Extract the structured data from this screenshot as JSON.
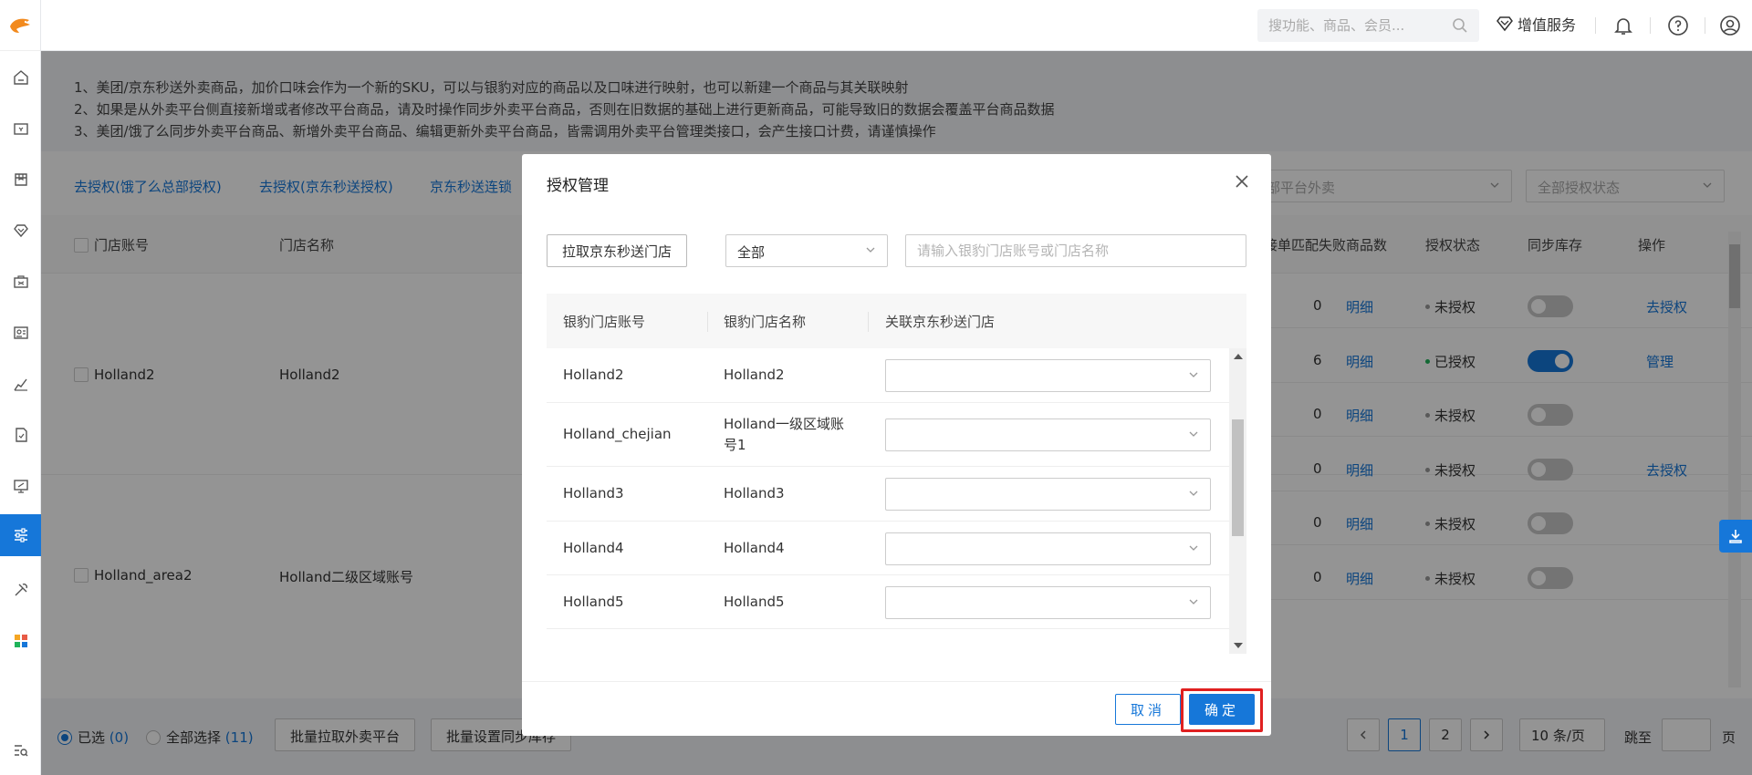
{
  "header": {
    "search_placeholder": "搜功能、商品、会员...",
    "vip_label": "增值服务"
  },
  "notice": {
    "lines": [
      "1、美团/京东秒送外卖商品，加价口味会作为一个新的SKU，可以与银豹对应的商品以及口味进行映射，也可以新建一个商品与其关联映射",
      "2、如果是从外卖平台侧直接新增或者修改平台商品，请及时操作同步外卖平台商品，否则在旧数据的基础上进行更新商品，可能导致旧的数据会覆盖平台商品数据",
      "3、美团/饿了么同步外卖平台商品、新增外卖平台商品、编辑更新外卖平台商品，皆需调用外卖平台管理类接口，会产生接口计费，请谨慎操作"
    ]
  },
  "toolbar": {
    "link1": "去授权(饿了么总部授权)",
    "link2": "去授权(京东秒送授权)",
    "link3": "京东秒送连锁",
    "platform_select": "部平台外卖",
    "auth_select": "全部授权状态"
  },
  "table": {
    "headers": {
      "account": "门店账号",
      "name": "门店名称",
      "fail_count": "接单匹配失败商品数",
      "auth_status": "授权状态",
      "sync_stock": "同步库存",
      "action": "操作"
    },
    "groups": [
      {
        "account": "Holland2",
        "name": "Holland2"
      },
      {
        "account": "Holland_area2",
        "name": "Holland二级区域账号"
      }
    ],
    "rows": [
      {
        "num": "0",
        "detail": "明细",
        "status": "未授权",
        "authorized": false,
        "action": "去授权"
      },
      {
        "num": "6",
        "detail": "明细",
        "status": "已授权",
        "authorized": true,
        "action": "管理"
      },
      {
        "num": "0",
        "detail": "明细",
        "status": "未授权",
        "authorized": false,
        "action": ""
      },
      {
        "num": "0",
        "detail": "明细",
        "status": "未授权",
        "authorized": false,
        "action": "去授权"
      },
      {
        "num": "0",
        "detail": "明细",
        "status": "未授权",
        "authorized": false,
        "action": ""
      },
      {
        "num": "0",
        "detail": "明细",
        "status": "未授权",
        "authorized": false,
        "action": ""
      }
    ]
  },
  "footer": {
    "selected_label": "已选",
    "selected_count": "(0)",
    "select_all_label": "全部选择",
    "select_all_count": "(11)",
    "batch_pull": "批量拉取外卖平台",
    "batch_sync": "批量设置同步库存",
    "page1": "1",
    "page2": "2",
    "page_size": "10 条/页",
    "jump_label": "跳至",
    "page_unit": "页"
  },
  "modal": {
    "title": "授权管理",
    "pull_button": "拉取京东秒送门店",
    "filter_value": "全部",
    "search_placeholder": "请输入银豹门店账号或门店名称",
    "columns": {
      "account": "银豹门店账号",
      "name": "银豹门店名称",
      "linked": "关联京东秒送门店"
    },
    "rows": [
      {
        "account": "Holland2",
        "name": "Holland2"
      },
      {
        "account": "Holland_chejian",
        "name": "Holland一级区域账号1"
      },
      {
        "account": "Holland3",
        "name": "Holland3"
      },
      {
        "account": "Holland4",
        "name": "Holland4"
      },
      {
        "account": "Holland5",
        "name": "Holland5"
      }
    ],
    "cancel": "取消",
    "confirm": "确定"
  },
  "colors": {
    "primary": "#1677d9",
    "highlight": "#e02020",
    "authorized_dot": "#1fb35a"
  }
}
